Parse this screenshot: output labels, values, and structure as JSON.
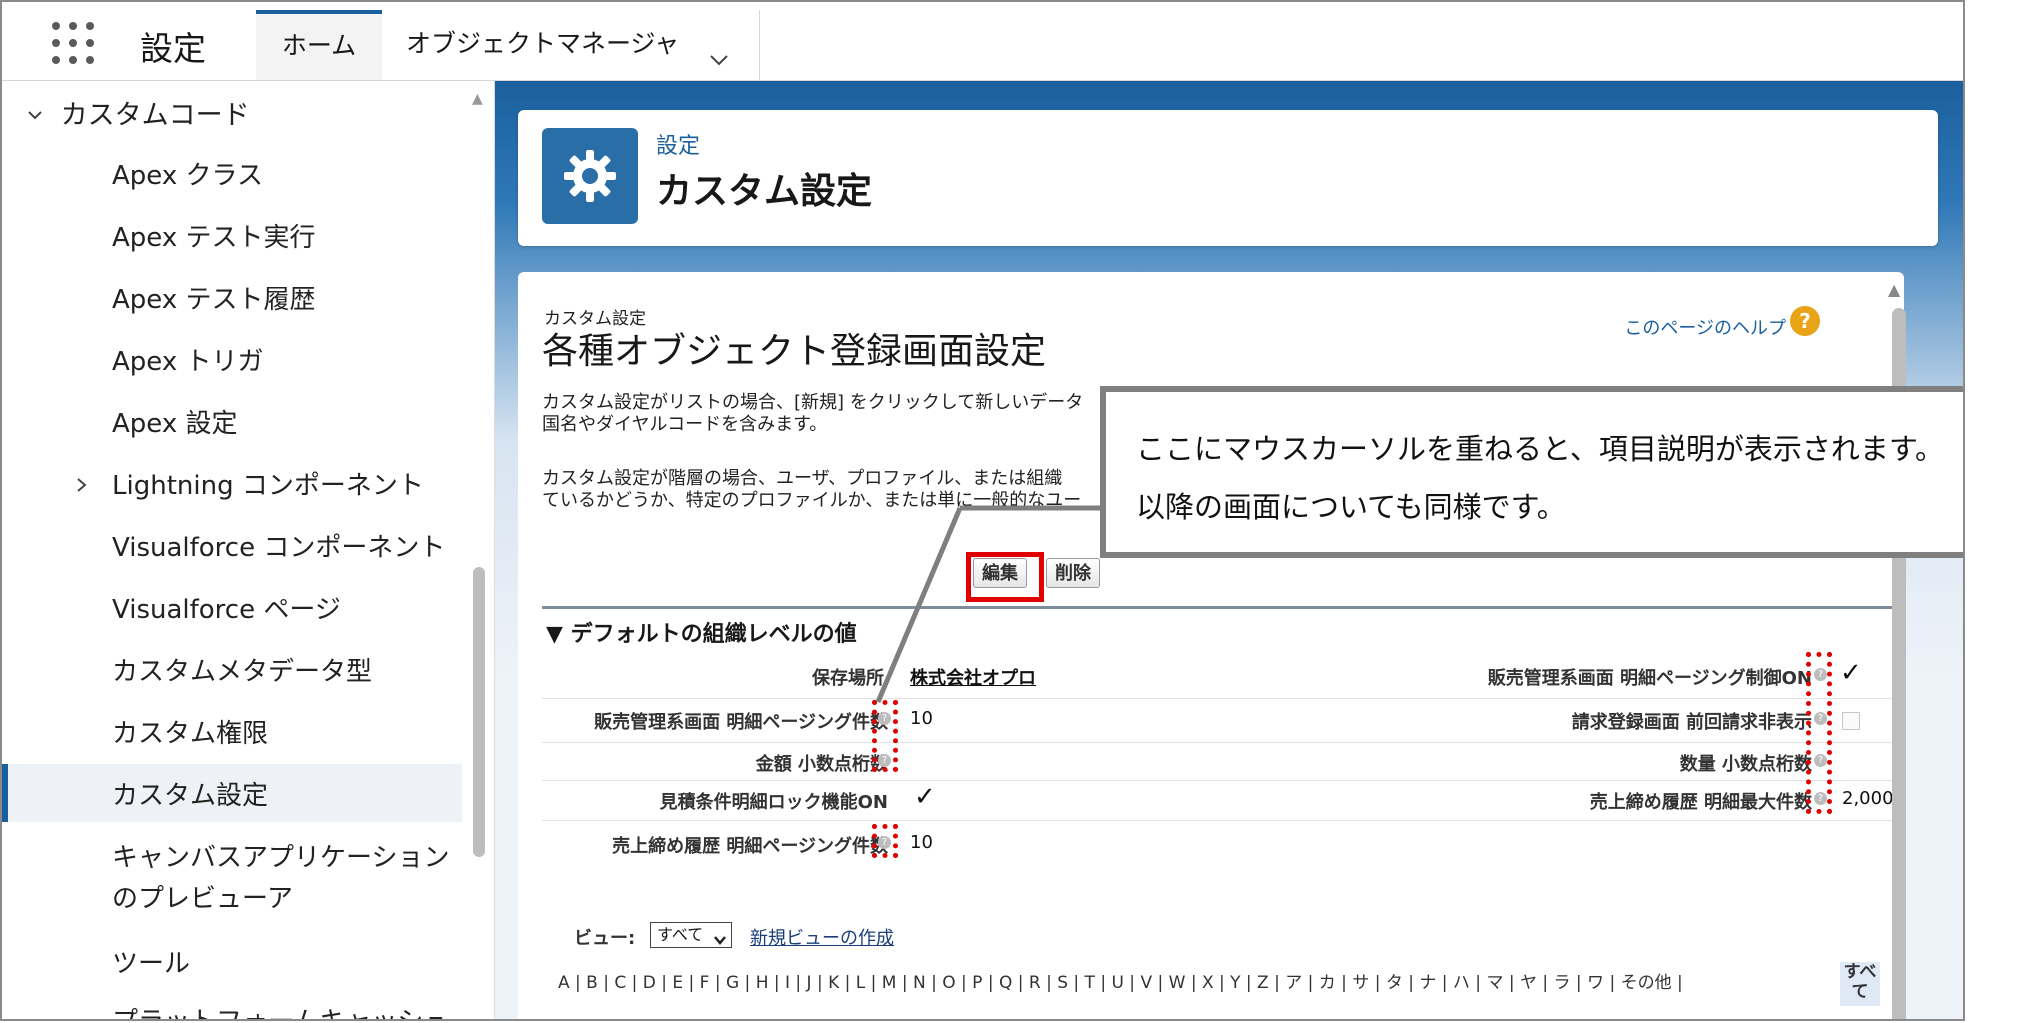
{
  "topbar": {
    "app_title": "設定",
    "tab_home": "ホーム",
    "tab_object_manager": "オブジェクトマネージャ"
  },
  "sidebar": {
    "parent_label": "カスタムコード",
    "items": [
      "Apex クラス",
      "Apex テスト実行",
      "Apex テスト履歴",
      "Apex トリガ",
      "Apex 設定",
      "Lightning コンポーネント",
      "Visualforce コンポーネント",
      "Visualforce ページ",
      "カスタムメタデータ型",
      "カスタム権限",
      "カスタム設定",
      "キャンバスアプリケーション",
      "のプレビューア",
      "ツール",
      "プラットフォームキャッシュ"
    ],
    "active_item": "カスタム設定"
  },
  "header": {
    "breadcrumb": "設定",
    "title": "カスタム設定"
  },
  "detail": {
    "sub_label": "カスタム設定",
    "title": "各種オブジェクト登録画面設定",
    "help_link": "このページのヘルプ",
    "help_icon": "?",
    "desc_line1": "カスタム設定がリストの場合、[新規] をクリックして新しいデータ",
    "desc_line2": "国名やダイヤルコードを含みます。",
    "desc_line3": "カスタム設定が階層の場合、ユーザ、プロファイル、または組織",
    "desc_line4": "ているかどうか、特定のプロファイルか、または単に一般的なユー",
    "edit_button": "編集",
    "delete_button": "削除",
    "section_title": "▼ デフォルトの組織レベルの値",
    "fields": {
      "location_label": "保存場所",
      "location_value": "株式会社オプロ",
      "sales_paging_ctrl_label": "販売管理系画面 明細ページング制御ON",
      "sales_paging_count_label": "販売管理系画面 明細ページング件数",
      "sales_paging_count_value": "10",
      "invoice_hide_label": "請求登録画面 前回請求非表示",
      "amount_decimal_label": "金額 小数点桁数",
      "qty_decimal_label": "数量 小数点桁数",
      "estimate_lock_label": "見積条件明細ロック機能ON",
      "sales_close_max_label": "売上締め履歴 明細最大件数",
      "sales_close_max_value": "2,000",
      "sales_close_paging_label": "売上締め履歴 明細ページング件数",
      "sales_close_paging_value": "10",
      "check_glyph": "✓"
    },
    "view_label": "ビュー:",
    "view_selected": "すべて",
    "view_new": "新規ビューの作成",
    "alphabet": "A | B | C | D | E | F | G | H | I | J | K | L | M | N | O | P | Q | R | S | T | U | V | W | X | Y | Z | ア | カ | サ | タ | ナ | ハ | マ | ヤ | ラ | ワ | その他 |",
    "alphabet_all_1": "すべ",
    "alphabet_all_2": "て"
  },
  "callout": {
    "line1": "ここにマウスカーソルを重ねると、項目説明が表示されます。",
    "line2": "以降の画面についても同様です。"
  },
  "colors": {
    "brand_blue": "#1b5f9e",
    "highlight_red": "#e00000",
    "callout_border": "#7f7f7f"
  }
}
